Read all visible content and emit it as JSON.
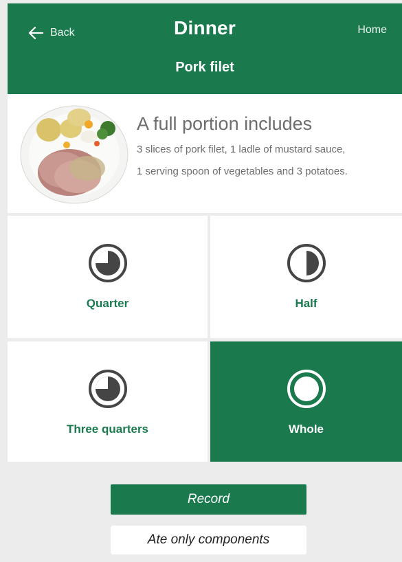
{
  "header": {
    "back_label": "Back",
    "title": "Dinner",
    "home_label": "Home",
    "subtitle": "Pork filet",
    "color": "#1a7a4e"
  },
  "info": {
    "heading": "A full portion includes",
    "line1": "3 slices of pork filet, 1 ladle of mustard sauce,",
    "line2": "1 serving spoon of vegetables and 3 potatoes."
  },
  "portions": [
    {
      "label": "Quarter",
      "icon": "quarter-pie-icon",
      "fraction": 0.25,
      "selected": false
    },
    {
      "label": "Half",
      "icon": "half-pie-icon",
      "fraction": 0.5,
      "selected": false
    },
    {
      "label": "Three quarters",
      "icon": "three-quarter-pie-icon",
      "fraction": 0.75,
      "selected": false
    },
    {
      "label": "Whole",
      "icon": "full-circle-icon",
      "fraction": 1.0,
      "selected": true
    }
  ],
  "actions": {
    "record_label": "Record",
    "components_label": "Ate only components"
  }
}
